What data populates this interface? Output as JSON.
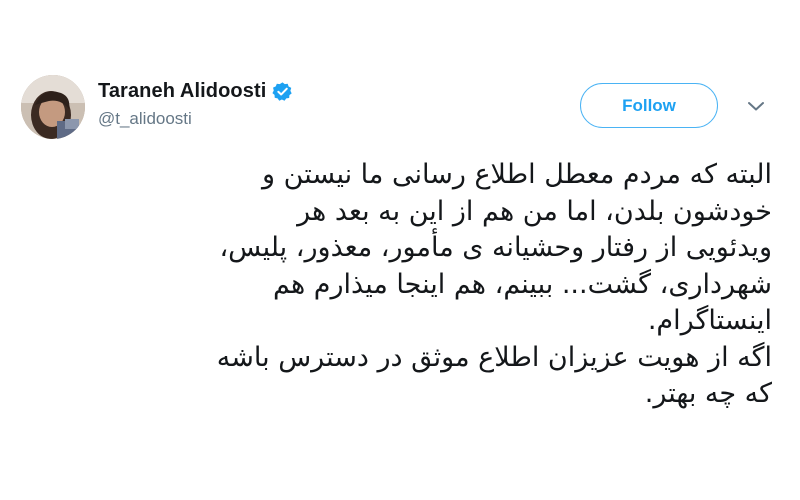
{
  "header": {
    "display_name": "Taraneh Alidoosti",
    "handle": "@t_alidoosti",
    "follow_label": "Follow",
    "verified": true
  },
  "icons": {
    "verified": "verified-badge-icon",
    "caret": "chevron-down-icon",
    "avatar": "profile-photo"
  },
  "colors": {
    "accent": "#1da1f2",
    "follow_border": "#4ab3f4",
    "handle": "#657786",
    "text": "#14171a",
    "caret": "#657786"
  },
  "tweet": {
    "lines": [
      "البته که مردم معطل اطلاع رسانی ما نیستن و",
      "خودشون بلدن، اما من هم از این به بعد هر",
      "ویدئویی از رفتار وحشیانه ی مأمور، معذور، پلیس،",
      "شهرداری، گشت... ببینم، هم اینجا میذارم هم",
      "اینستاگرام.",
      "اگه از هویت عزیزان اطلاع موثق در دسترس باشه",
      "که چه بهتر."
    ]
  }
}
